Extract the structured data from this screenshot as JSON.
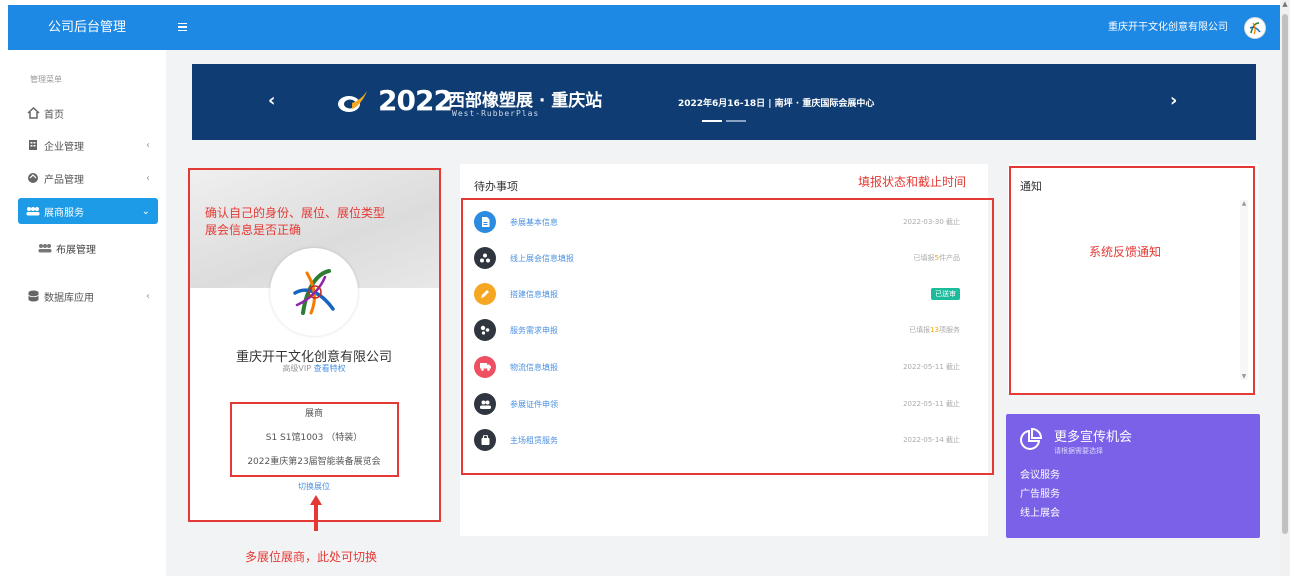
{
  "topbar": {
    "app_title": "公司后台管理",
    "company": "重庆开干文化创意有限公司"
  },
  "sidebar": {
    "heading": "管理菜单",
    "items": [
      {
        "label": "首页",
        "icon": "home-icon"
      },
      {
        "label": "企业管理",
        "icon": "building-icon"
      },
      {
        "label": "产品管理",
        "icon": "product-icon"
      },
      {
        "label": "展商服务",
        "icon": "exhibitor-icon"
      },
      {
        "label": "布展管理",
        "icon": "exhibitor-icon"
      },
      {
        "label": "数据库应用",
        "icon": "database-icon"
      }
    ],
    "chevron_left": "‹",
    "chevron_down": "⌄"
  },
  "banner": {
    "year": "2022",
    "name": "西部橡塑展 · 重庆站",
    "name_en": "West-RubberPlas",
    "date_place": "2022年6月16-18日  |  南坪 · 重庆国际会展中心",
    "prev": "‹",
    "next": "›"
  },
  "profile": {
    "company": "重庆开干文化创意有限公司",
    "vip_level": "高级VIP ",
    "vip_link": "查看特权",
    "role": "展商",
    "booth": "S1 S1馆1003 （特装）",
    "expo": "2022重庆第23届智能装备展览会",
    "switch_label": "切换展位"
  },
  "todo": {
    "title": "待办事项",
    "items": [
      {
        "label": "参展基本信息",
        "status": "2022-03-30 截止",
        "color": "#2a8be0",
        "icon": "document-icon"
      },
      {
        "label": "线上展会信息填报",
        "status_pre": "已填报",
        "status_hl": "5",
        "status_post": "件产品",
        "color": "#2f3640",
        "icon": "network-icon"
      },
      {
        "label": "搭建信息填报",
        "badge": "已送审",
        "color": "#f5a623",
        "icon": "pencil-icon"
      },
      {
        "label": "服务需求申报",
        "status_pre": "已填报",
        "status_hl": "13",
        "status_post": "项服务",
        "color": "#2f3640",
        "icon": "service-icon"
      },
      {
        "label": "物流信息填报",
        "status": "2022-05-11 截止",
        "color": "#ef5061",
        "icon": "truck-icon"
      },
      {
        "label": "参展证件申领",
        "status": "2022-05-11 截止",
        "color": "#2f3640",
        "icon": "users-icon"
      },
      {
        "label": "主场租赁服务",
        "status": "2022-05-14 截止",
        "color": "#2f3640",
        "icon": "bag-icon"
      }
    ]
  },
  "notice": {
    "title": "通知"
  },
  "promo": {
    "title": "更多宣传机会",
    "subtitle": "请根据需要选择",
    "links": [
      "会议服务",
      "广告服务",
      "线上展会"
    ]
  },
  "annotations": {
    "profile_note_line1": "确认自己的身份、展位、展位类型",
    "profile_note_line2": "展会信息是否正确",
    "todo_note": "填报状态和截止时间",
    "notice_note": "系统反馈通知",
    "switch_note": "多展位展商，此处可切换"
  },
  "colors": {
    "topbar": "#1e88e5",
    "banner": "#0f3d73",
    "active_nav": "#1e9be6",
    "promo": "#7b61e8",
    "annotation": "#e53935"
  }
}
